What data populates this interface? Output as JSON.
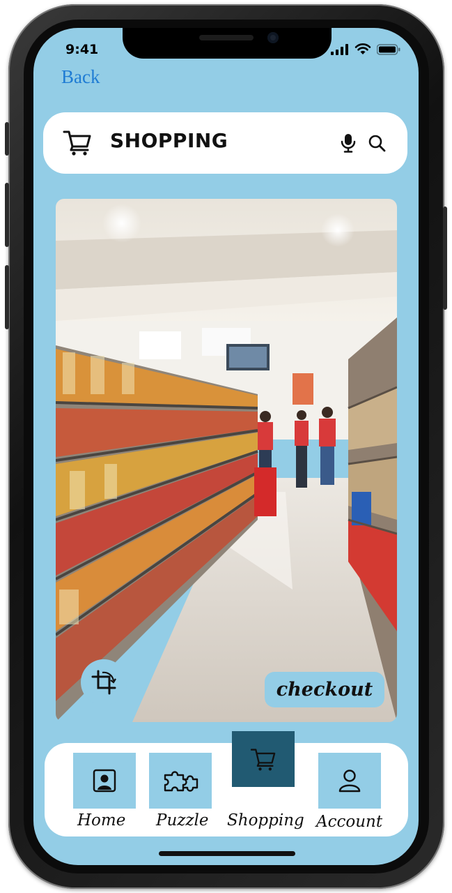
{
  "status_bar": {
    "time": "9:41"
  },
  "nav": {
    "back_label": "Back"
  },
  "search": {
    "title": "SHOPPING"
  },
  "photo": {
    "checkout_label": "checkout"
  },
  "bottom_nav": {
    "items": [
      {
        "label": "Home",
        "icon": "person-portrait-icon",
        "active": false
      },
      {
        "label": "Puzzle",
        "icon": "puzzle-piece-icon",
        "active": false
      },
      {
        "label": "Shopping",
        "icon": "shopping-cart-icon",
        "active": true
      },
      {
        "label": "Account",
        "icon": "user-icon",
        "active": false
      }
    ]
  },
  "colors": {
    "screen_background": "#93cde6",
    "tile": "#93cde6",
    "active_tile": "#215a72",
    "back_link": "#1f7cd4"
  }
}
